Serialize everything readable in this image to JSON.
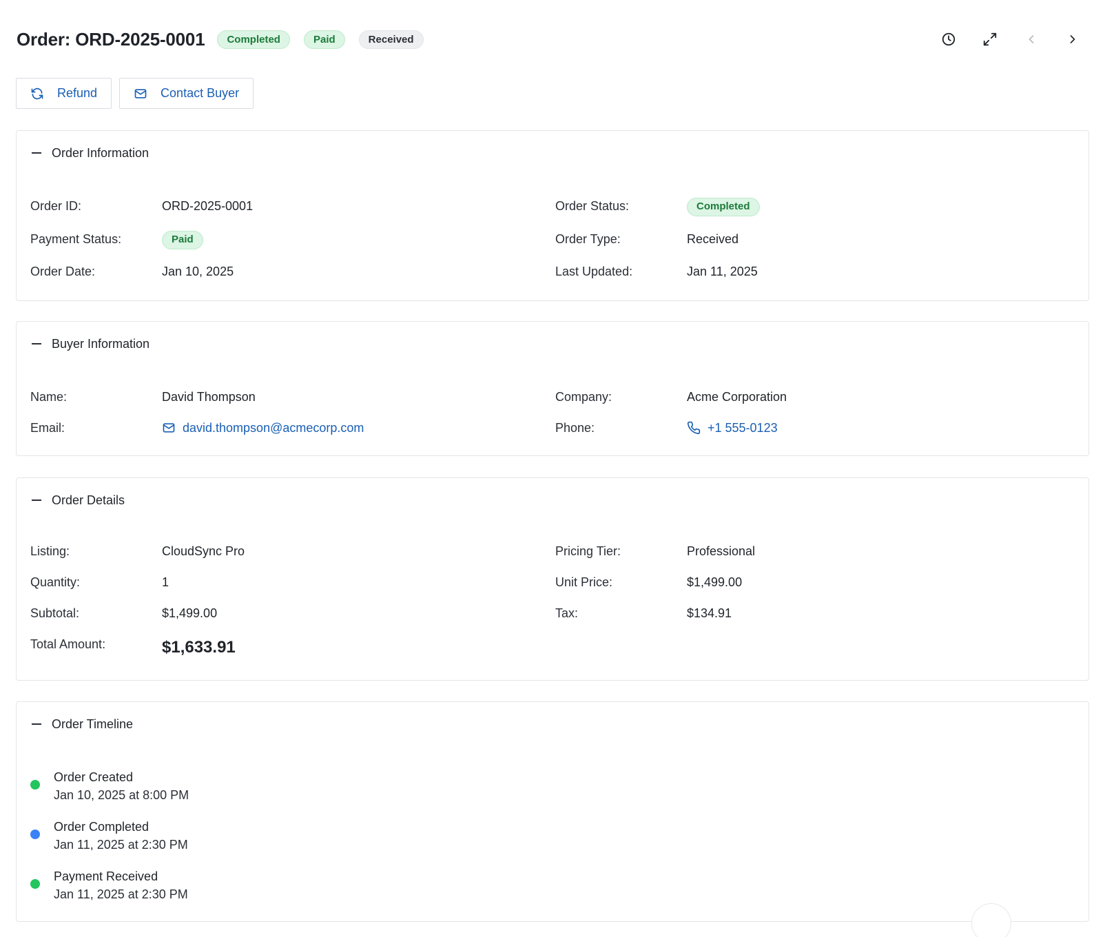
{
  "header": {
    "title": "Order: ORD-2025-0001",
    "badges": [
      "Completed",
      "Paid",
      "Received"
    ],
    "icons": [
      "history-icon",
      "expand-icon",
      "chevron-left-icon",
      "chevron-right-icon"
    ]
  },
  "actions": {
    "refund_label": "Refund",
    "contact_label": "Contact Buyer"
  },
  "order_info": {
    "title": "Order Information",
    "order_id_label": "Order ID:",
    "order_id": "ORD-2025-0001",
    "order_status_label": "Order Status:",
    "order_status": "Completed",
    "payment_status_label": "Payment Status:",
    "payment_status": "Paid",
    "order_type_label": "Order Type:",
    "order_type": "Received",
    "order_date_label": "Order Date:",
    "order_date": "Jan 10, 2025",
    "last_updated_label": "Last Updated:",
    "last_updated": "Jan 11, 2025"
  },
  "buyer_info": {
    "title": "Buyer Information",
    "name_label": "Name:",
    "name": "David Thompson",
    "company_label": "Company:",
    "company": "Acme Corporation",
    "email_label": "Email:",
    "email": "david.thompson@acmecorp.com",
    "phone_label": "Phone:",
    "phone": "+1 555-0123"
  },
  "order_details": {
    "title": "Order Details",
    "listing_label": "Listing:",
    "listing": "CloudSync Pro",
    "pricing_tier_label": "Pricing Tier:",
    "pricing_tier": "Professional",
    "quantity_label": "Quantity:",
    "quantity": "1",
    "unit_price_label": "Unit Price:",
    "unit_price": "$1,499.00",
    "subtotal_label": "Subtotal:",
    "subtotal": "$1,499.00",
    "tax_label": "Tax:",
    "tax": "$134.91",
    "total_label": "Total Amount:",
    "total": "$1,633.91"
  },
  "timeline": {
    "title": "Order Timeline",
    "events": [
      {
        "title": "Order Created",
        "time": "Jan 10, 2025 at 8:00 PM",
        "color": "#22c55e"
      },
      {
        "title": "Order Completed",
        "time": "Jan 11, 2025 at 2:30 PM",
        "color": "#3b82f6"
      },
      {
        "title": "Payment Received",
        "time": "Jan 11, 2025 at 2:30 PM",
        "color": "#22c55e"
      }
    ]
  },
  "colors": {
    "accent": "#1a5fb4",
    "success_bg": "#dcf5e4",
    "success_text": "#1c7a3a"
  }
}
